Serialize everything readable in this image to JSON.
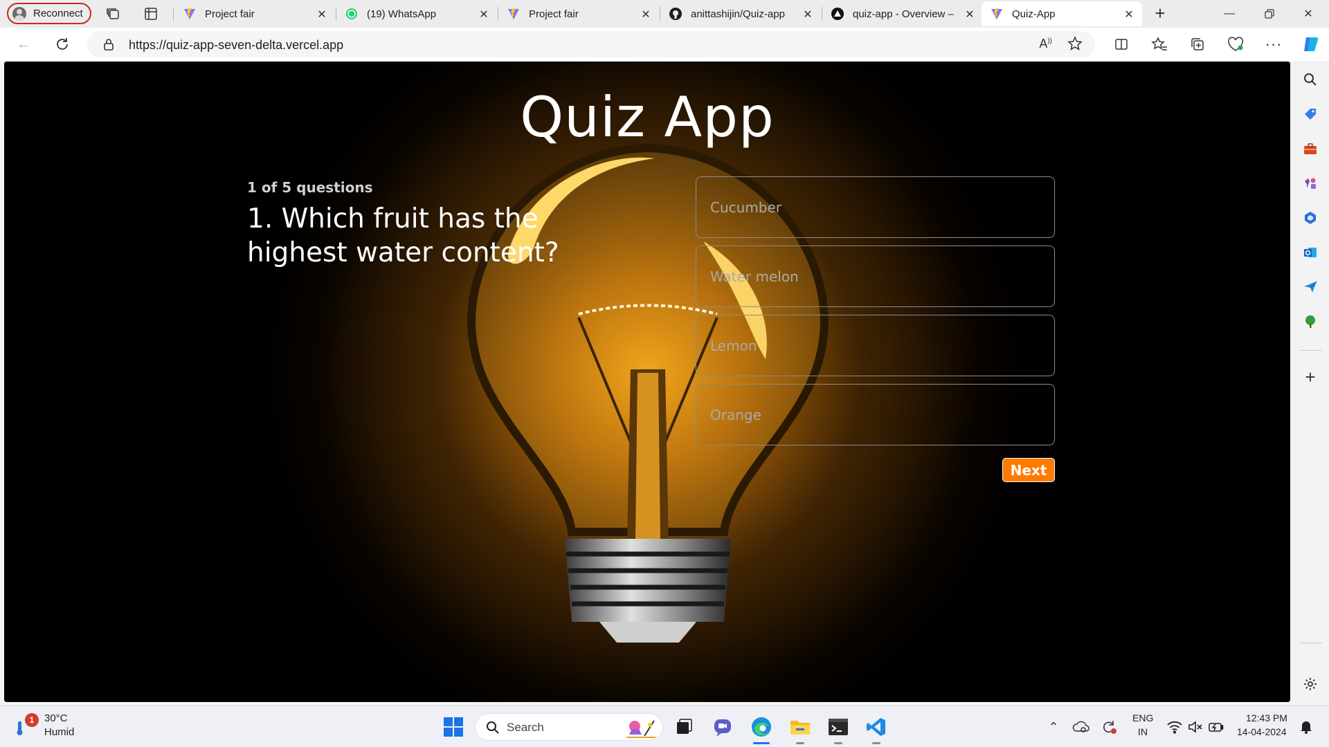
{
  "browser": {
    "profile_label": "Reconnect",
    "tabs": [
      {
        "title": "Project fair",
        "active": false
      },
      {
        "title": "(19) WhatsApp",
        "active": false
      },
      {
        "title": "Project fair",
        "active": false
      },
      {
        "title": "anittashijin/Quiz-app",
        "active": false
      },
      {
        "title": "quiz-app - Overview –",
        "active": false
      },
      {
        "title": "Quiz-App",
        "active": true
      }
    ],
    "url": "https://quiz-app-seven-delta.vercel.app"
  },
  "page": {
    "title": "Quiz App",
    "question_count": "1 of 5 questions",
    "question": "1. Which fruit has the highest water content?",
    "options": [
      "Cucumber",
      "Water melon",
      "Lemon",
      "Orange"
    ],
    "next_label": "Next",
    "accent_color": "#ff7a00"
  },
  "taskbar": {
    "weather_temp": "30°C",
    "weather_desc": "Humid",
    "weather_badge": "1",
    "search_placeholder": "Search",
    "lang_line1": "ENG",
    "lang_line2": "IN",
    "time": "12:43 PM",
    "date": "14-04-2024"
  }
}
